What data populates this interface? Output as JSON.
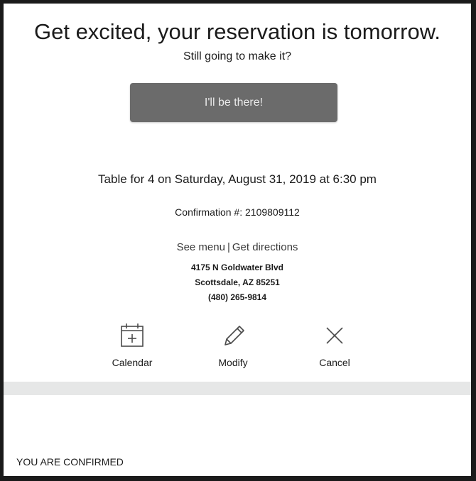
{
  "header": {
    "headline": "Get excited, your reservation is tomorrow.",
    "subhead": "Still going to make it?"
  },
  "cta": {
    "label": "I'll be there!"
  },
  "reservation": {
    "details": "Table for 4 on Saturday, August 31, 2019 at 6:30 pm",
    "confirmation": "Confirmation #: 2109809112"
  },
  "links": {
    "see_menu": "See menu",
    "separator": "|",
    "get_directions": "Get directions"
  },
  "address": {
    "street": "4175 N Goldwater Blvd",
    "city_state_zip": "Scottsdale, AZ 85251",
    "phone": "(480) 265-9814"
  },
  "actions": [
    {
      "label": "Calendar",
      "icon": "calendar-add-icon"
    },
    {
      "label": "Modify",
      "icon": "pencil-icon"
    },
    {
      "label": "Cancel",
      "icon": "close-icon"
    }
  ],
  "footer": {
    "status": "YOU ARE CONFIRMED"
  },
  "colors": {
    "button": "#6b6b6b",
    "divider": "#e6e7e7",
    "border": "#1a1a1a"
  }
}
